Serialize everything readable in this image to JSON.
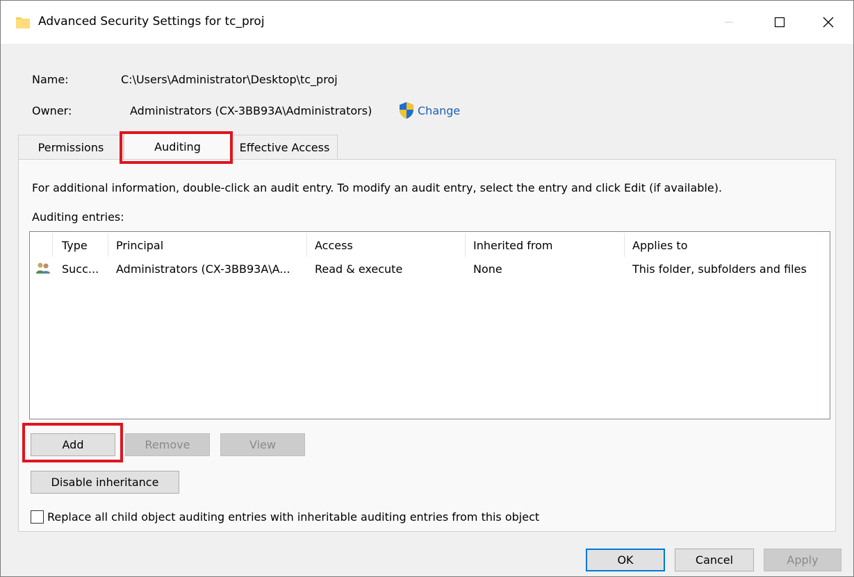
{
  "window": {
    "title": "Advanced Security Settings for tc_proj"
  },
  "info": {
    "name_label": "Name:",
    "name_value": "C:\\Users\\Administrator\\Desktop\\tc_proj",
    "owner_label": "Owner:",
    "owner_value": "Administrators (CX-3BB93A\\Administrators)",
    "change_link": "Change"
  },
  "tabs": [
    {
      "label": "Permissions",
      "active": false
    },
    {
      "label": "Auditing",
      "active": true
    },
    {
      "label": "Effective Access",
      "active": false
    }
  ],
  "auditing": {
    "info_text": "For additional information, double-click an audit entry. To modify an audit entry, select the entry and click Edit (if available).",
    "entries_label": "Auditing entries:",
    "columns": [
      "Type",
      "Principal",
      "Access",
      "Inherited from",
      "Applies to"
    ],
    "rows": [
      {
        "type": "Succ...",
        "principal": "Administrators (CX-3BB93A\\A...",
        "access": "Read & execute",
        "inherited_from": "None",
        "applies_to": "This folder, subfolders and files"
      }
    ],
    "add_button": "Add",
    "remove_button": "Remove",
    "view_button": "View",
    "disable_inheritance_button": "Disable inheritance",
    "replace_checkbox_label": "Replace all child object auditing entries with inheritable auditing entries from this object",
    "replace_checked": false
  },
  "footer": {
    "ok": "OK",
    "cancel": "Cancel",
    "apply": "Apply"
  },
  "colors": {
    "highlight": "#e0141e",
    "link": "#1a5fb4",
    "shield_blue": "#1c6fd1",
    "shield_yellow": "#f2c230"
  }
}
